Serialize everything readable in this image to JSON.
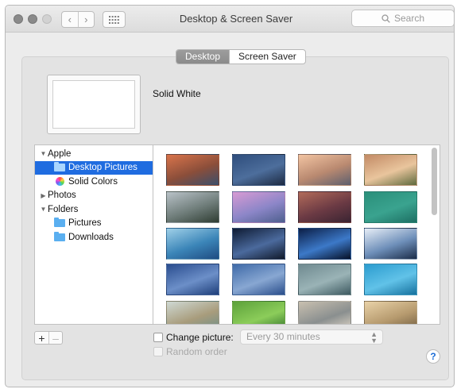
{
  "window": {
    "title": "Desktop & Screen Saver"
  },
  "toolbar": {
    "back_icon": "chevron-left-icon",
    "forward_icon": "chevron-right-icon",
    "grid_icon": "grid-icon",
    "back_glyph": "‹",
    "forward_glyph": "›",
    "search_placeholder": "Search"
  },
  "tabs": [
    {
      "label": "Desktop",
      "active": true
    },
    {
      "label": "Screen Saver",
      "active": false
    }
  ],
  "current": {
    "name": "Solid White"
  },
  "sidebar": {
    "items": [
      {
        "label": "Apple",
        "disclosure": "▼",
        "icon": "",
        "selected": false
      },
      {
        "label": "Desktop Pictures",
        "disclosure": "",
        "icon": "folder-icon",
        "selected": true
      },
      {
        "label": "Solid Colors",
        "disclosure": "",
        "icon": "color-wheel-icon",
        "selected": false
      },
      {
        "label": "Photos",
        "disclosure": "▶",
        "icon": "",
        "selected": false
      },
      {
        "label": "Folders",
        "disclosure": "▼",
        "icon": "",
        "selected": false
      },
      {
        "label": "Pictures",
        "disclosure": "",
        "icon": "folder-icon",
        "selected": false
      },
      {
        "label": "Downloads",
        "disclosure": "",
        "icon": "folder-icon",
        "selected": false
      }
    ]
  },
  "thumbnails": [
    {
      "name": "el-capitan",
      "colors": [
        "#d9744b",
        "#8b4e3a",
        "#3b4f6b"
      ]
    },
    {
      "name": "el-capitan-2",
      "colors": [
        "#2e4d7c",
        "#4d6e9c",
        "#1d2b43"
      ]
    },
    {
      "name": "yosemite",
      "colors": [
        "#f2c4a2",
        "#b98970",
        "#5d5f6e"
      ]
    },
    {
      "name": "yosemite-2",
      "colors": [
        "#c28a65",
        "#e9c59d",
        "#5f6b3e"
      ]
    },
    {
      "name": "yosemite-3",
      "colors": [
        "#b9c2c8",
        "#6f7d7a",
        "#2f3d33"
      ]
    },
    {
      "name": "yosemite-4",
      "colors": [
        "#d89bd4",
        "#8c86c8",
        "#4e5f8e"
      ]
    },
    {
      "name": "yosemite-5",
      "colors": [
        "#b26b5a",
        "#6b3a44",
        "#3a2432"
      ]
    },
    {
      "name": "mavericks",
      "colors": [
        "#2a8f7a",
        "#3aa38f",
        "#1d6f63"
      ]
    },
    {
      "name": "wave",
      "colors": [
        "#9fd0e8",
        "#3b85b8",
        "#1f4c82"
      ]
    },
    {
      "name": "galaxy",
      "colors": [
        "#0e1b33",
        "#4b6a9d",
        "#111a2a"
      ]
    },
    {
      "name": "earth-horizon",
      "colors": [
        "#0b1e46",
        "#3c79c8",
        "#061027"
      ]
    },
    {
      "name": "lion",
      "colors": [
        "#e7eef7",
        "#6e8fb9",
        "#1b2c48"
      ]
    },
    {
      "name": "blue-sky",
      "colors": [
        "#2a4d8f",
        "#6c8fc8",
        "#1f3f7a"
      ]
    },
    {
      "name": "moon-sky",
      "colors": [
        "#3f6aa8",
        "#88a7d2",
        "#2b4f8c"
      ]
    },
    {
      "name": "ocean-waves",
      "colors": [
        "#6f8a90",
        "#9ab3b6",
        "#3e5a61"
      ]
    },
    {
      "name": "water-ripples",
      "colors": [
        "#2b9ccf",
        "#61c2e8",
        "#17729f"
      ]
    },
    {
      "name": "beach",
      "colors": [
        "#cfd9d4",
        "#a89c7c",
        "#6b8f8a"
      ]
    },
    {
      "name": "fields",
      "colors": [
        "#5ca13a",
        "#8ccd5a",
        "#2d6e28"
      ]
    },
    {
      "name": "abstract-sand",
      "colors": [
        "#c9c0b0",
        "#8a8f8f",
        "#e6dccb"
      ]
    },
    {
      "name": "forest-fog",
      "colors": [
        "#e9d2a8",
        "#b69a6e",
        "#6d5a3e"
      ]
    }
  ],
  "footer": {
    "add_glyph": "+",
    "remove_glyph": "–",
    "change_picture_label": "Change picture:",
    "interval_value": "Every 30 minutes",
    "random_order_label": "Random order",
    "help_glyph": "?"
  }
}
